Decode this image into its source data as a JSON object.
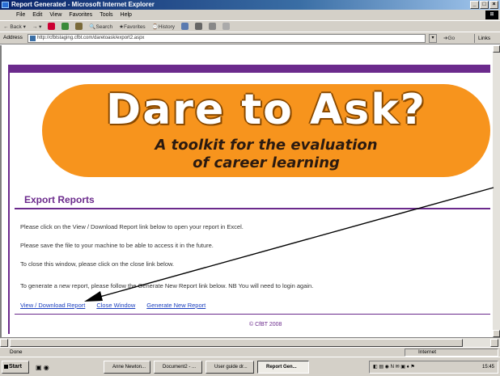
{
  "window": {
    "title": "Report Generated - Microsoft Internet Explorer",
    "controls": [
      "_",
      "□",
      "×"
    ]
  },
  "menu": [
    "File",
    "Edit",
    "View",
    "Favorites",
    "Tools",
    "Help"
  ],
  "toolbar": {
    "back": "Back",
    "search": "Search",
    "favorites": "Favorites",
    "history": "History"
  },
  "address": {
    "label": "Address",
    "url": "http://cfbtstaging.cfbt.com/daretoask/export2.aspx",
    "go": "Go",
    "links": "Links"
  },
  "banner": {
    "title": "Dare to Ask?",
    "subtitle_line1": "A toolkit for the evaluation",
    "subtitle_line2": "of career learning",
    "color": "#f7941d"
  },
  "content": {
    "heading": "Export Reports",
    "lines": [
      "Please click on the View / Download Report link below to open your report in Excel.",
      "Please save the file to your machine to be able to access it in the future.",
      "To close this window, please click on the close link below.",
      "To generate a new report, please follow the Generate New Report link below. NB You will need to login again."
    ],
    "links": {
      "download": "View / Download Report",
      "close": "Close Window",
      "generate": "Generate New Report"
    },
    "footer": "© CfBT 2008",
    "accent": "#6b2a8c"
  },
  "status": {
    "left": "Done",
    "zone": "Internet"
  },
  "taskbar": {
    "start": "Start",
    "buttons": [
      "Anne Newton...",
      "Document2 - ...",
      "User guide dr...",
      "Report Gen..."
    ],
    "clock": "15:45"
  }
}
